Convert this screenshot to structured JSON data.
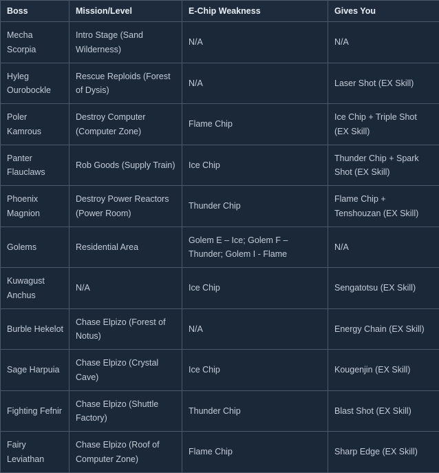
{
  "table": {
    "name": "mega-man-zero-boss-table",
    "columns": [
      {
        "key": "boss",
        "label": "Boss"
      },
      {
        "key": "mission",
        "label": "Mission/Level"
      },
      {
        "key": "weak",
        "label": "E-Chip Weakness"
      },
      {
        "key": "gives",
        "label": "Gives You"
      }
    ],
    "rows": [
      {
        "boss": "Mecha Scorpia",
        "mission": "Intro Stage (Sand Wilderness)",
        "weak": "N/A",
        "gives": "N/A"
      },
      {
        "boss": "Hyleg Ourobockle",
        "mission": "Rescue Reploids (Forest of Dysis)",
        "weak": "N/A",
        "gives": "Laser Shot (EX Skill)"
      },
      {
        "boss": "Poler Kamrous",
        "mission": "Destroy Computer (Computer Zone)",
        "weak": "Flame Chip",
        "gives": "Ice Chip + Triple Shot (EX Skill)"
      },
      {
        "boss": "Panter Flauclaws",
        "mission": "Rob Goods (Supply Train)",
        "weak": "Ice Chip",
        "gives": "Thunder Chip + Spark Shot (EX Skill)"
      },
      {
        "boss": "Phoenix Magnion",
        "mission": "Destroy Power Reactors (Power Room)",
        "weak": "Thunder Chip",
        "gives": "Flame Chip + Tenshouzan (EX Skill)"
      },
      {
        "boss": "Golems",
        "mission": "Residential Area",
        "weak": "Golem E – Ice; Golem F – Thunder; Golem I - Flame",
        "gives": "N/A"
      },
      {
        "boss": "Kuwagust Anchus",
        "mission": "N/A",
        "weak": "Ice Chip",
        "gives": "Sengatotsu (EX Skill)"
      },
      {
        "boss": "Burble Hekelot",
        "mission": "Chase Elpizo (Forest of Notus)",
        "weak": "N/A",
        "gives": "Energy Chain (EX Skill)"
      },
      {
        "boss": "Sage Harpuia",
        "mission": "Chase Elpizo (Crystal Cave)",
        "weak": "Ice Chip",
        "gives": "Kougenjin (EX Skill)"
      },
      {
        "boss": "Fighting Fefnir",
        "mission": "Chase Elpizo (Shuttle Factory)",
        "weak": "Thunder Chip",
        "gives": "Blast Shot (EX Skill)"
      },
      {
        "boss": "Fairy Leviathan",
        "mission": "Chase Elpizo (Roof of Computer Zone)",
        "weak": "Flame Chip",
        "gives": "Sharp Edge (EX Skill)"
      }
    ]
  },
  "colors": {
    "page_background": "#1b2838",
    "header_background": "#1d2b3c",
    "cell_background": "#1b2838",
    "border": "#4a5a6a",
    "header_text": "#e9eef3",
    "body_text": "#c3ccd6"
  }
}
